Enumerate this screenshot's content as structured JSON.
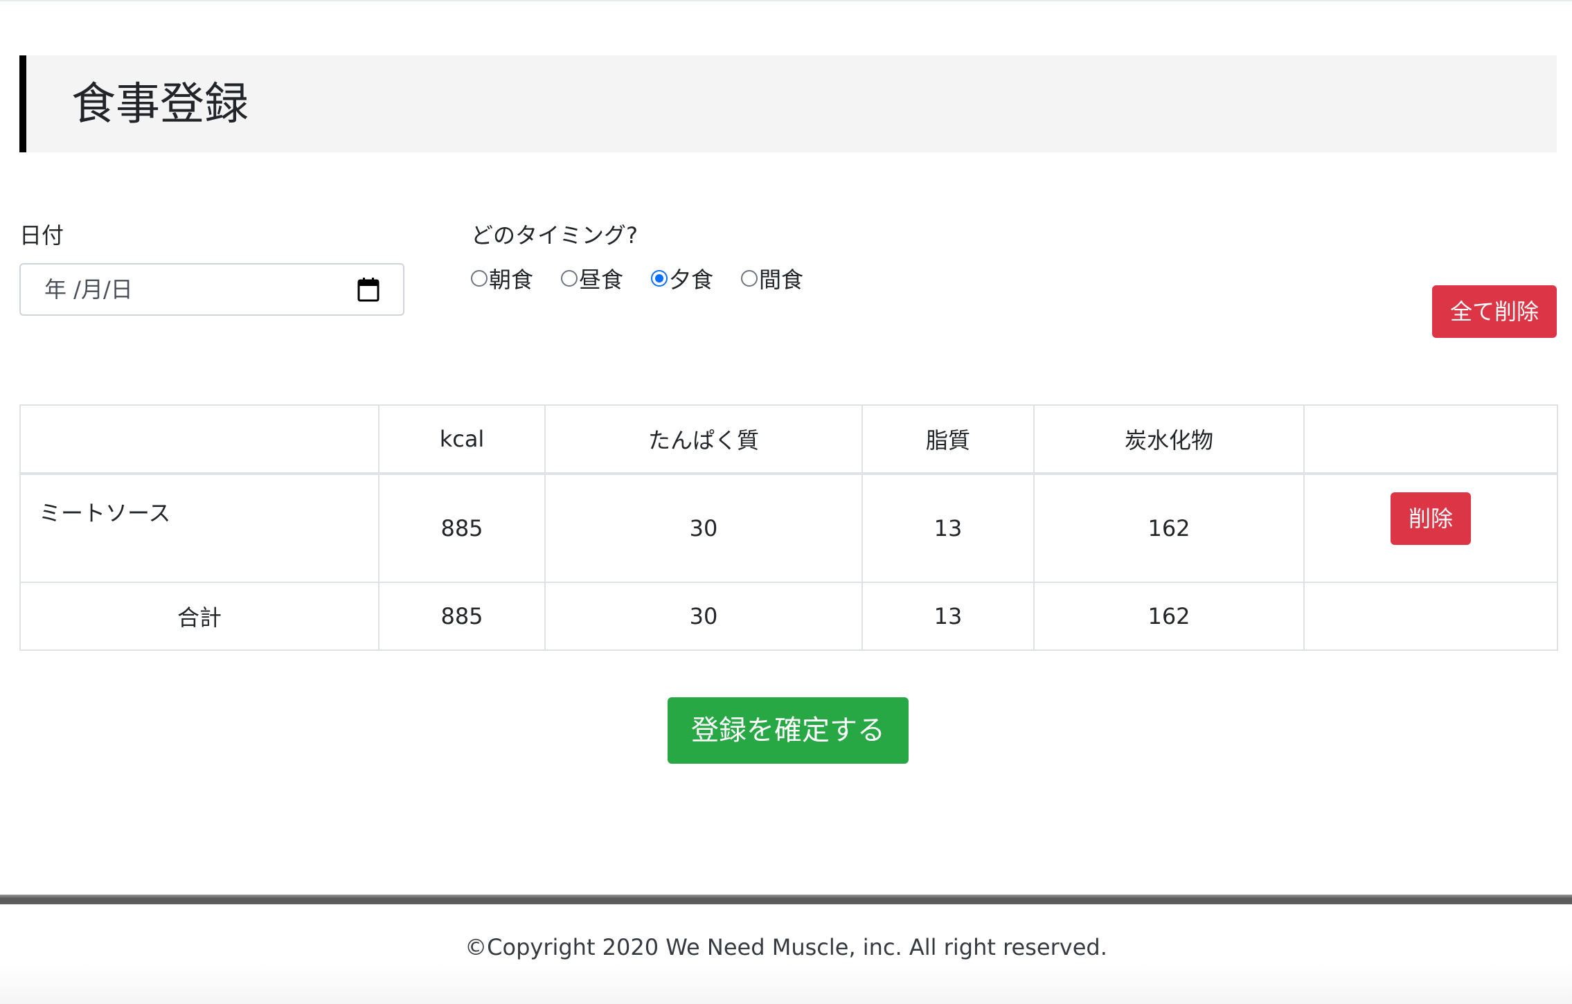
{
  "page": {
    "title": "食事登録"
  },
  "form": {
    "date_label": "日付",
    "date_placeholder": "年 /月/日",
    "timing_label": "どのタイミング?",
    "timings": [
      {
        "label": "朝食",
        "checked": false
      },
      {
        "label": "昼食",
        "checked": false
      },
      {
        "label": "夕食",
        "checked": true
      },
      {
        "label": "間食",
        "checked": false
      }
    ],
    "delete_all_label": "全て削除"
  },
  "table": {
    "headers": [
      "",
      "kcal",
      "たんぱく質",
      "脂質",
      "炭水化物",
      ""
    ],
    "rows": [
      {
        "name": "ミートソース",
        "kcal": "885",
        "protein": "30",
        "fat": "13",
        "carbs": "162",
        "delete_label": "削除"
      }
    ],
    "total": {
      "label": "合計",
      "kcal": "885",
      "protein": "30",
      "fat": "13",
      "carbs": "162"
    }
  },
  "confirm_label": "登録を確定する",
  "footer": {
    "copyright": "©Copyright 2020 We Need Muscle, inc. All right reserved."
  },
  "colors": {
    "danger": "#dc3545",
    "success": "#28a745",
    "radio_checked": "#0d6efd"
  },
  "icons": {
    "date_picker": "calendar-icon"
  }
}
